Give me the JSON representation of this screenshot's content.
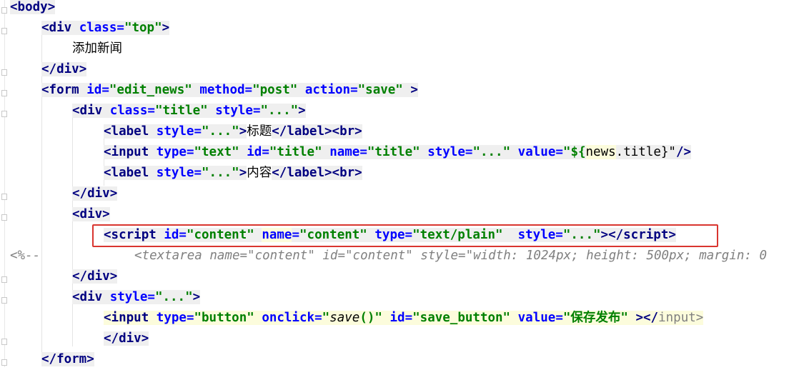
{
  "code": {
    "l1": {
      "open": "<",
      "tag": "body",
      "close": ">"
    },
    "l2": {
      "open": "<",
      "tag": "div",
      "attr1": "class",
      "val1": "\"top\"",
      "close": ">"
    },
    "l3": {
      "text": "添加新闻"
    },
    "l4": {
      "open": "</",
      "tag": "div",
      "close": ">"
    },
    "l5": {
      "open": "<",
      "tag": "form",
      "attr1": "id",
      "val1": "\"edit_news\"",
      "attr2": "method",
      "val2": "\"post\"",
      "attr3": "action",
      "val3": "\"save\"",
      "close": " >"
    },
    "l6": {
      "open": "<",
      "tag": "div",
      "attr1": "class",
      "val1": "\"title\"",
      "attr2": "style",
      "val2": "\"...\"",
      "close": ">"
    },
    "l7": {
      "open": "<",
      "tag": "label",
      "attr1": "style",
      "val1": "\"...\"",
      "close1": ">",
      "text": "标题",
      "close2": "</",
      "tag2": "label",
      "close3": "><",
      "tag3": "br",
      "close4": ">"
    },
    "l8": {
      "open": "<",
      "tag": "input",
      "attr1": "type",
      "val1": "\"text\"",
      "attr2": "id",
      "val2": "\"title\"",
      "attr3": "name",
      "val3": "\"title\"",
      "attr4": "style",
      "val4": "\"...\"",
      "attr5": "value",
      "val5a": "\"${",
      "val5b": "news",
      "val5c": ".title}\"",
      "close": "/>"
    },
    "l9": {
      "open": "<",
      "tag": "label",
      "attr1": "style",
      "val1": "\"...\"",
      "close1": ">",
      "text": "内容",
      "close2": "</",
      "tag2": "label",
      "close3": "><",
      "tag3": "br",
      "close4": ">"
    },
    "l10": {
      "open": "</",
      "tag": "div",
      "close": ">"
    },
    "l11": {
      "open": "<",
      "tag": "div",
      "close": ">"
    },
    "l12": {
      "open": "<",
      "tag": "script",
      "attr1": "id",
      "val1": "\"content\"",
      "attr2": "name",
      "val2": "\"content\"",
      "attr3": "type",
      "val3": "\"text/plain\"",
      "attr4": "style",
      "val4": "\"...\"",
      "close": "></",
      "tag2": "script",
      "close2": ">"
    },
    "l13": {
      "comment_start": "<%--",
      "comment_body": "<textarea name=\"content\" id=\"content\" style=\"width: 1024px; height: 500px; margin: 0"
    },
    "l14": {
      "open": "</",
      "tag": "div",
      "close": ">"
    },
    "l15": {
      "open": "<",
      "tag": "div",
      "attr1": "style",
      "val1": "\"...\"",
      "close": ">"
    },
    "l16": {
      "open": "<",
      "tag": "input",
      "attr1": "type",
      "val1": "\"button\"",
      "attr2": "onclick",
      "val2a": "\"",
      "val2fn": "save",
      "val2b": "()\"",
      "attr3": "id",
      "val3": "\"save_button\"",
      "attr4": "value",
      "val4": "\"保存发布\"",
      "close": " ></",
      "tag2": "input",
      "close2": ">"
    },
    "l17": {
      "open": "</",
      "tag": "div",
      "close": ">"
    },
    "l18": {
      "open": "</",
      "tag": "form",
      "close": ">"
    }
  },
  "colors": {
    "tag": "#000080",
    "attr": "#0000ff",
    "string": "#008000",
    "comment": "#808080",
    "highlight_box": "#d9352f"
  }
}
